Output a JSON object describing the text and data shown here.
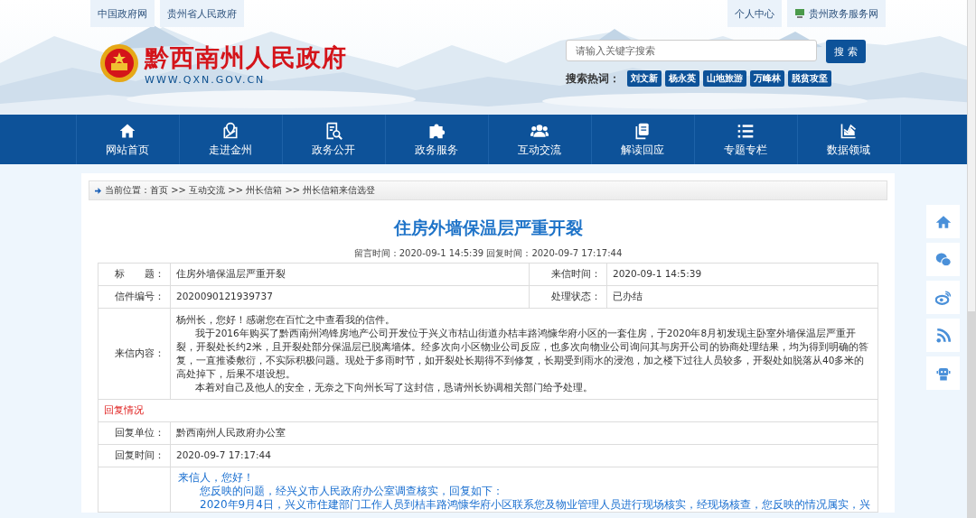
{
  "top_links": {
    "left": [
      "中国政府网",
      "贵州省人民政府"
    ],
    "right": [
      {
        "label": "个人中心",
        "kind": "text"
      },
      {
        "label": "贵州政务服务网",
        "kind": "icon"
      }
    ]
  },
  "site": {
    "name": "黔西南州人民政府",
    "url": "WWW.QXN.GOV.CN"
  },
  "search": {
    "placeholder": "请输入关键字搜索",
    "button": "搜 索",
    "hot_label": "搜索热词：",
    "hot_words": [
      "刘文新",
      "杨永英",
      "山地旅游",
      "万峰林",
      "脱贫攻坚"
    ]
  },
  "nav": [
    {
      "label": "网站首页",
      "kind": "home"
    },
    {
      "label": "走进金州",
      "kind": "map"
    },
    {
      "label": "政务公开",
      "kind": "doc"
    },
    {
      "label": "政务服务",
      "kind": "puzzle"
    },
    {
      "label": "互动交流",
      "kind": "people"
    },
    {
      "label": "解读回应",
      "kind": "copy"
    },
    {
      "label": "专题专栏",
      "kind": "list"
    },
    {
      "label": "数据领域",
      "kind": "chart"
    }
  ],
  "breadcrumb": "当前位置：首页 >> 互动交流 >> 州长信箱 >> 州长信箱来信选登",
  "letter": {
    "title": "住房外墙保温层严重开裂",
    "meta": "留言时间：2020-09-1 14:5:39 回复时间：2020-09-7 17:17:44",
    "info": [
      {
        "label": "标　　题：",
        "value": "住房外墙保温层严重开裂"
      },
      {
        "label": "来信时间：",
        "value": "2020-09-1 14:5:39"
      },
      {
        "label": "信件编号：",
        "value": "2020090121939737"
      },
      {
        "label": "处理状态：",
        "value": "已办结"
      }
    ],
    "content_label": "来信内容：",
    "paragraphs": [
      "杨州长，您好！感谢您在百忙之中查看我的信件。",
      "我于2016年购买了黔西南州鸿锋房地产公司开发位于兴义市桔山街道办桔丰路鸿慷华府小区的一套住房，于2020年8月初发现主卧室外墙保温层严重开裂，开裂处长约2米，且开裂处部分保温层已脱离墙体。经多次向小区物业公司反应，也多次向物业公司询问其与房开公司的协商处理结果，均为得到明确的答复，一直推诿敷衍，不实际积极问题。现处于多雨时节，如开裂处长期得不到修复，长期受到雨水的浸泡，加之楼下过往人员较多，开裂处如脱落从40多米的高处掉下，后果不堪设想。",
      "本着对自己及他人的安全，无奈之下向州长写了这封信，恳请州长协调相关部门给予处理。"
    ]
  },
  "reply": {
    "heading": "回复情况",
    "fields": [
      {
        "label": "回复单位：",
        "value": "黔西南州人民政府办公室"
      },
      {
        "label": "回复时间：",
        "value": "2020-09-7 17:17:44"
      }
    ],
    "paragraphs": [
      "来信人，您好！",
      "您反映的问题，经兴义市人民政府办公室调查核实，回复如下：",
      "2020年9月4日，兴义市住建部门工作人员到桔丰路鸿慷华府小区联系您及物业管理人员进行现场核实，经现场核查，您反映的情况属实，兴"
    ]
  },
  "side_icons": [
    {
      "kind": "home"
    },
    {
      "kind": "wechat"
    },
    {
      "kind": "weibo"
    },
    {
      "kind": "rss"
    },
    {
      "kind": "robot"
    }
  ]
}
